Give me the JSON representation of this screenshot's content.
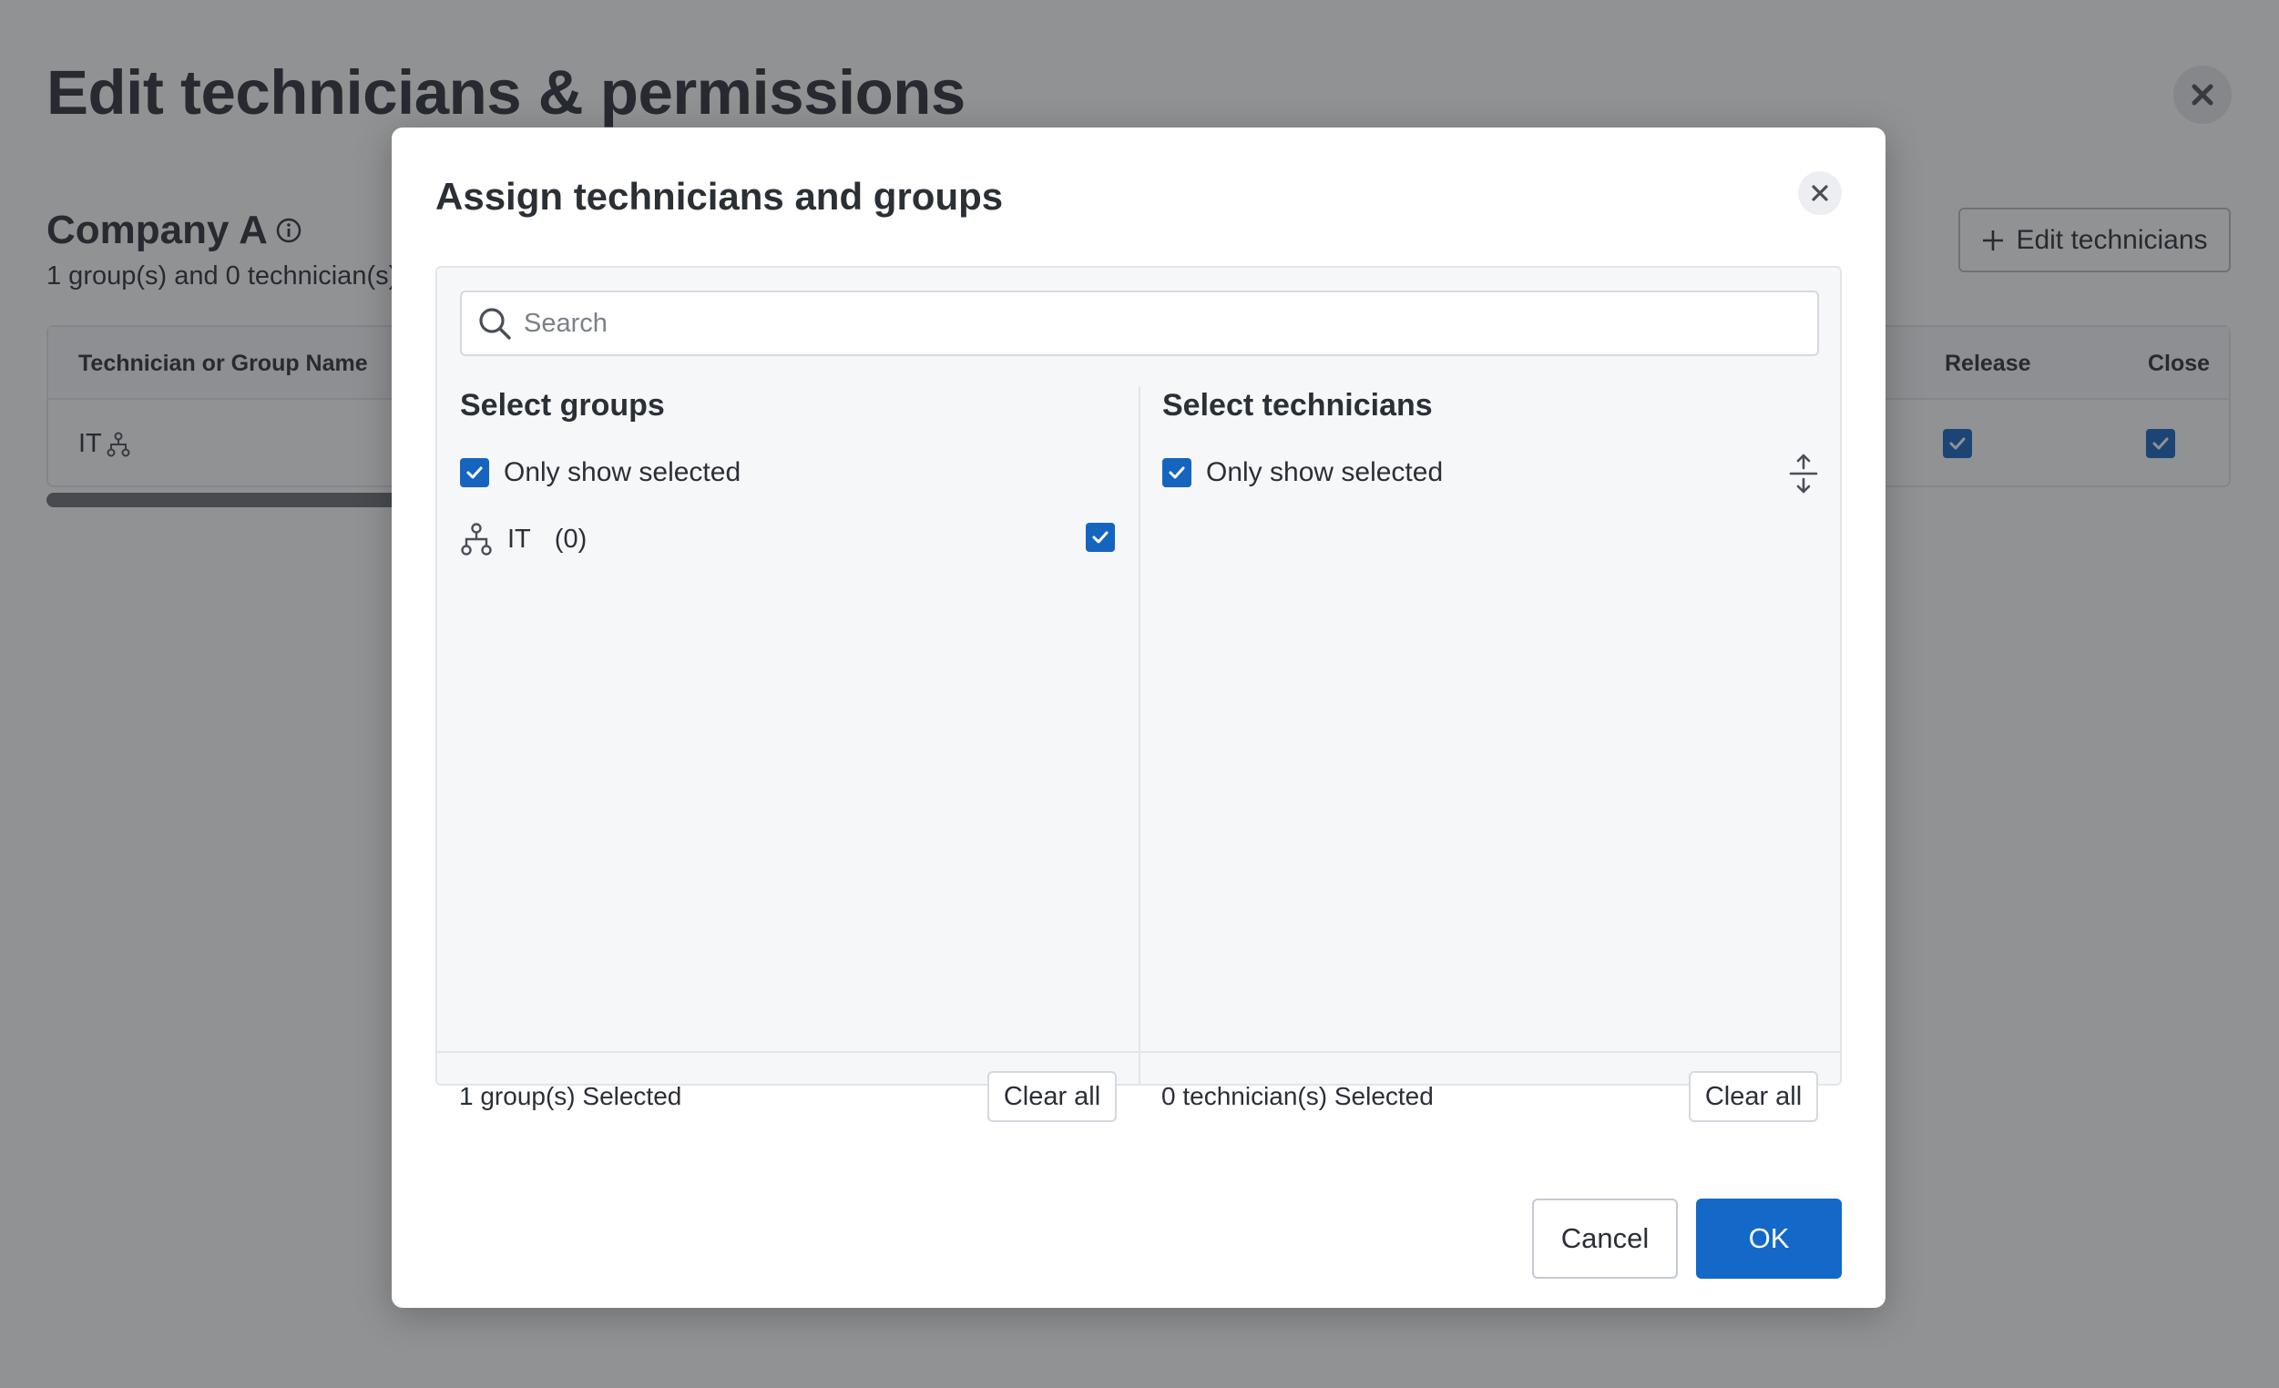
{
  "page": {
    "title": "Edit technicians & permissions",
    "company": {
      "name": "Company A",
      "summary": "1 group(s) and 0 technician(s)"
    },
    "edit_technicians_label": "Edit technicians",
    "table": {
      "columns": [
        "Technician or Group Name",
        "Release",
        "Close"
      ],
      "rows": [
        {
          "name": "IT",
          "release": true,
          "close": true
        }
      ]
    }
  },
  "modal": {
    "title": "Assign technicians and groups",
    "search": {
      "placeholder": "Search",
      "value": ""
    },
    "groups": {
      "title": "Select groups",
      "only_show_selected_label": "Only show selected",
      "only_show_selected": true,
      "items": [
        {
          "name": "IT",
          "count": "(0)",
          "checked": true
        }
      ],
      "footer_text": "1 group(s) Selected",
      "clear_label": "Clear all"
    },
    "technicians": {
      "title": "Select technicians",
      "only_show_selected_label": "Only show selected",
      "only_show_selected": true,
      "items": [],
      "footer_text": "0 technician(s) Selected",
      "clear_label": "Clear all"
    },
    "cancel_label": "Cancel",
    "ok_label": "OK"
  },
  "colors": {
    "accent": "#1468c8",
    "checkbox": "#1565c0",
    "overlay": "rgba(35,37,42,0.5)"
  },
  "icons": [
    "close-icon",
    "info-icon",
    "plus-icon",
    "group-icon",
    "search-icon",
    "check-icon",
    "collapse-icon"
  ]
}
